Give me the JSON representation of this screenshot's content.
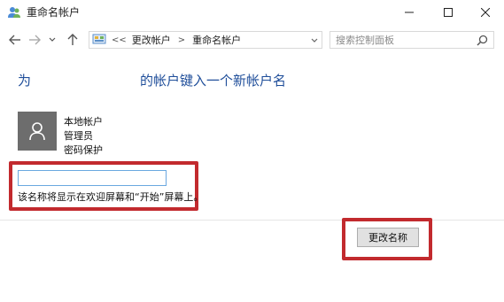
{
  "window": {
    "title": "重命名帐户",
    "icons": {
      "app": "users-icon",
      "minimize": "minimize-icon",
      "maximize": "maximize-icon",
      "close": "close-icon"
    }
  },
  "nav": {
    "icons": {
      "back": "arrow-left-icon",
      "forward": "arrow-right-icon",
      "recent": "chevron-down-icon",
      "up": "arrow-up-icon"
    },
    "breadcrumb": [
      "更改帐户",
      "重命名帐户"
    ],
    "breadcrumb_prefix": "<<",
    "separator": ">",
    "search_placeholder": "搜索控制面板"
  },
  "content": {
    "heading_prefix": "为",
    "heading_suffix": "的帐户键入一个新帐户名",
    "account_info": [
      "本地帐户",
      "管理员",
      "密码保护"
    ],
    "name_input_value": "",
    "hint": "该名称将显示在欢迎屏幕和“开始”屏幕上。",
    "rename_button": "更改名称"
  },
  "colors": {
    "heading": "#1f4e9a",
    "highlight_box": "#c22a2e",
    "avatar_bg": "#6d6d6d",
    "input_border": "#6aa8e0"
  }
}
